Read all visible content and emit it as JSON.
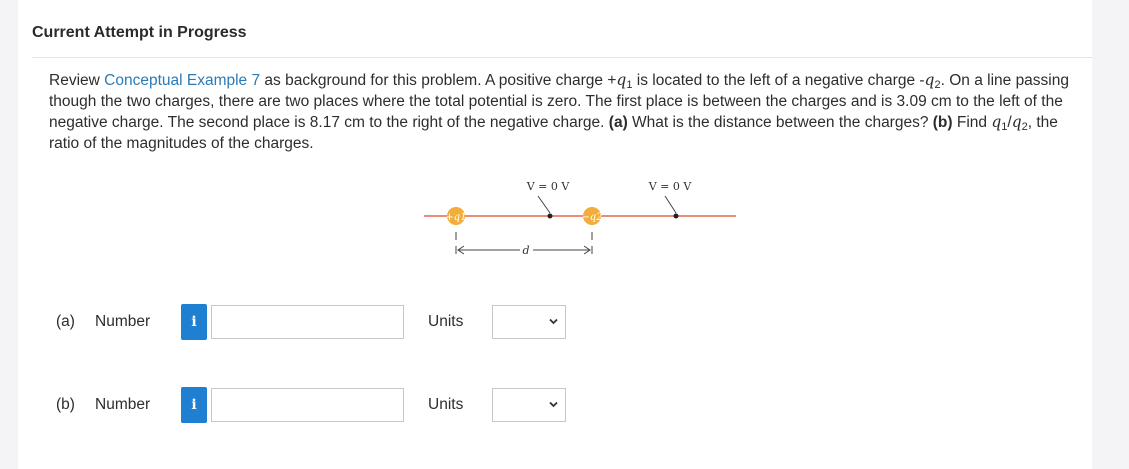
{
  "header": {
    "title": "Current Attempt in Progress"
  },
  "problem": {
    "text_before_link": "Review ",
    "link_text": "Conceptual Example 7",
    "text_1": " as background for this problem. A positive charge +",
    "q": "q",
    "sub1": "1",
    "text_2": " is located to the left of a negative charge -",
    "sub2": "2",
    "text_3": ". On a line passing though the two charges, there are two places where the total potential is zero. The first place is between the charges and is 3.09 cm to the left of the negative charge. The second place is 8.17 cm to the right of the negative charge. ",
    "part_a_label": "(a)",
    "text_4": " What is the distance between the charges? ",
    "part_b_label": "(b)",
    "text_5": " Find ",
    "slash": "/",
    "text_6": ", the ratio of the magnitudes of the charges."
  },
  "figure": {
    "v_label_1": "V = 0 V",
    "v_label_2": "V = 0 V",
    "charge_pos_label": "+q1",
    "charge_neg_label": "−q2",
    "distance_label": "d",
    "colors": {
      "line": "#e0472b",
      "charge_fill": "#f2ad3d",
      "charge_text": "#ffffff",
      "ink": "#333333"
    }
  },
  "answers": [
    {
      "part_label": "(a)",
      "number_label": "Number",
      "info_icon_glyph": "i",
      "value": "",
      "units_label": "Units",
      "units_selected": ""
    },
    {
      "part_label": "(b)",
      "number_label": "Number",
      "info_icon_glyph": "i",
      "value": "",
      "units_label": "Units",
      "units_selected": ""
    }
  ]
}
